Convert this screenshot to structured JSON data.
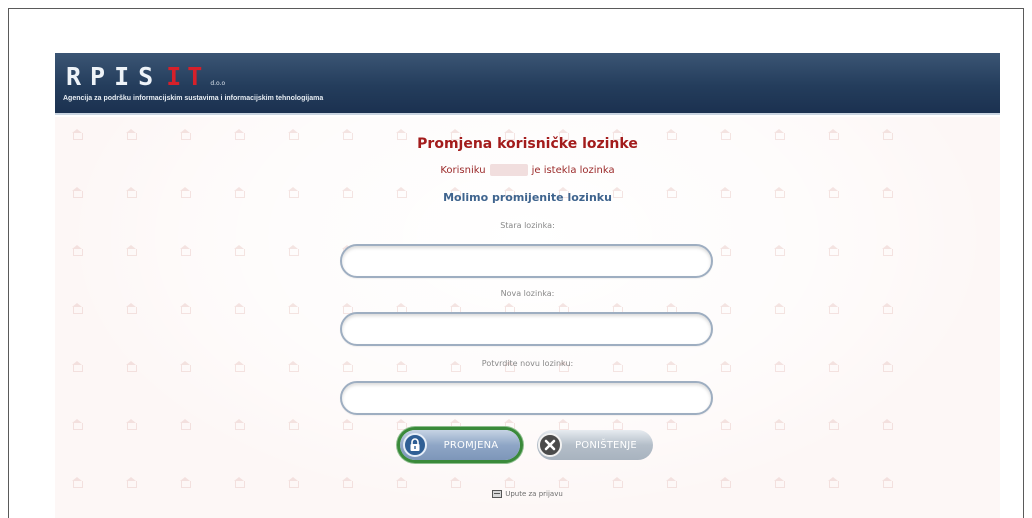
{
  "header": {
    "logo_rpis": "RPIS",
    "logo_it": "IT",
    "logo_suffix": "d.o.o",
    "tagline": "Agencija za podršku informacijskim sustavima i informacijskim tehnologijama"
  },
  "form": {
    "title": "Promjena korisničke lozinke",
    "expired_prefix": "Korisniku",
    "expired_suffix": "je istekla lozinka",
    "subtitle": "Molimo promijenite lozinku",
    "old_password_label": "Stara lozinka:",
    "new_password_label": "Nova lozinka:",
    "confirm_password_label": "Potvrdite novu lozinku:",
    "old_password_value": "",
    "new_password_value": "",
    "confirm_password_value": ""
  },
  "buttons": {
    "submit_label": "PROMJENA",
    "cancel_label": "PONIŠTENJE",
    "submit_icon": "lock-icon",
    "cancel_icon": "close-icon"
  },
  "footer": {
    "help_link": "Upute za prijavu",
    "help_icon": "monitor-icon"
  },
  "colors": {
    "header_bg": "#243d5c",
    "title_red": "#a31c1c",
    "subtitle_blue": "#3f648e",
    "highlight_green": "#3a8a3a"
  }
}
